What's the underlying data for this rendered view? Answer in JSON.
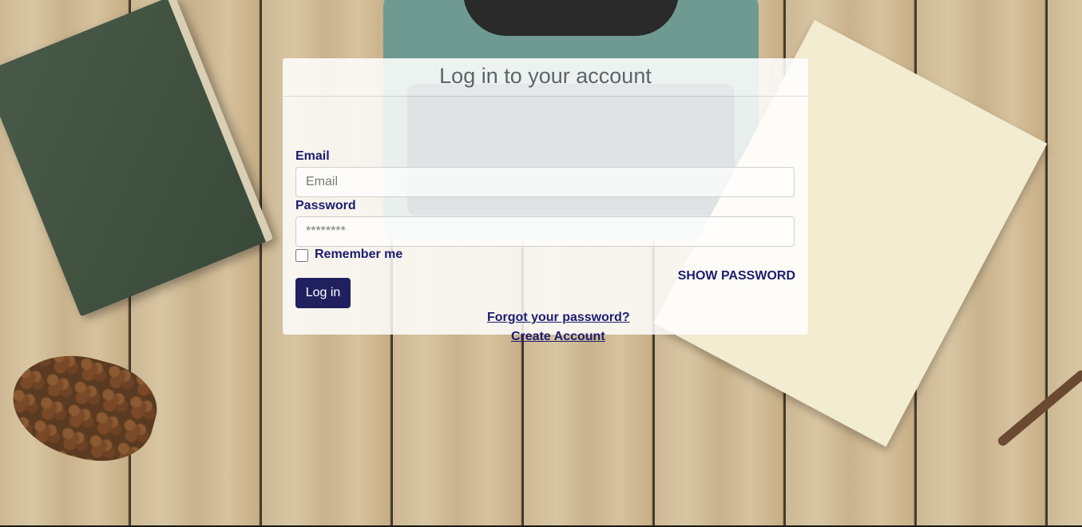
{
  "page": {
    "title": "Log in to your account"
  },
  "form": {
    "email_label": "Email",
    "email_placeholder": "Email",
    "email_value": "",
    "password_label": "Password",
    "password_placeholder": "********",
    "password_value": "",
    "remember_label": "Remember me",
    "remember_checked": false,
    "show_password_label": "SHOW PASSWORD",
    "submit_label": "Log in"
  },
  "links": {
    "forgot_password": "Forgot your password?",
    "create_account": "Create Account"
  },
  "colors": {
    "accent": "#1c1c70",
    "button_bg": "#20205e",
    "title_text": "#5f6468"
  }
}
